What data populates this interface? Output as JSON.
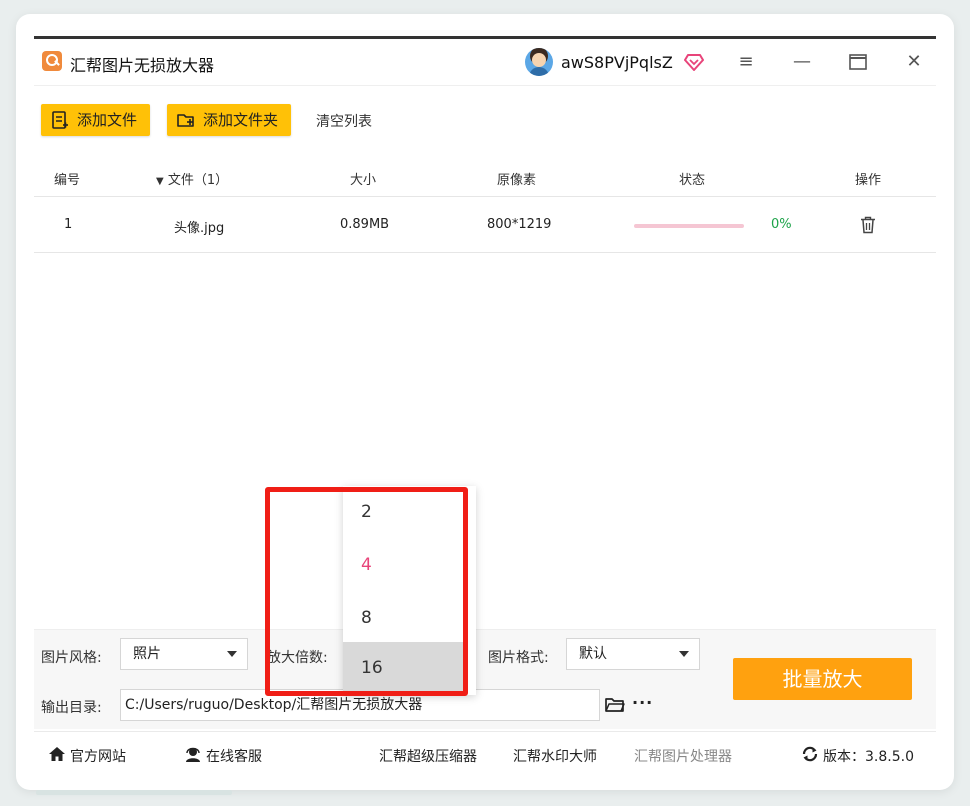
{
  "app": {
    "title": "汇帮图片无损放大器",
    "username": "awS8PVjPqlsZ",
    "accent": "#ffc107",
    "primary": "#ffa10f"
  },
  "toolbar": {
    "add_file": "添加文件",
    "add_folder": "添加文件夹",
    "clear_list": "清空列表"
  },
  "table": {
    "headers": {
      "index": "编号",
      "file": "文件（1）",
      "size": "大小",
      "pixels": "原像素",
      "status": "状态",
      "action": "操作"
    },
    "rows": [
      {
        "index": "1",
        "file": "头像.jpg",
        "size": "0.89MB",
        "pixels": "800*1219",
        "progress": 0,
        "percent": "0%"
      }
    ]
  },
  "settings": {
    "style_label": "图片风格:",
    "style_value": "照片",
    "scale_label": "放大倍数:",
    "format_label": "图片格式:",
    "format_value": "默认",
    "output_label": "输出目录:",
    "output_path": "C:/Users/ruguo/Desktop/汇帮图片无损放大器",
    "more": "···",
    "batch_button": "批量放大"
  },
  "dropdown": {
    "options": [
      "2",
      "4",
      "8",
      "16"
    ],
    "selected": "4",
    "hovered": "16"
  },
  "footer": {
    "website": "官方网站",
    "support": "在线客服",
    "compressor": "汇帮超级压缩器",
    "watermark": "汇帮水印大师",
    "processor": "汇帮图片处理器",
    "version_label": "版本：",
    "version": "3.8.5.0"
  }
}
